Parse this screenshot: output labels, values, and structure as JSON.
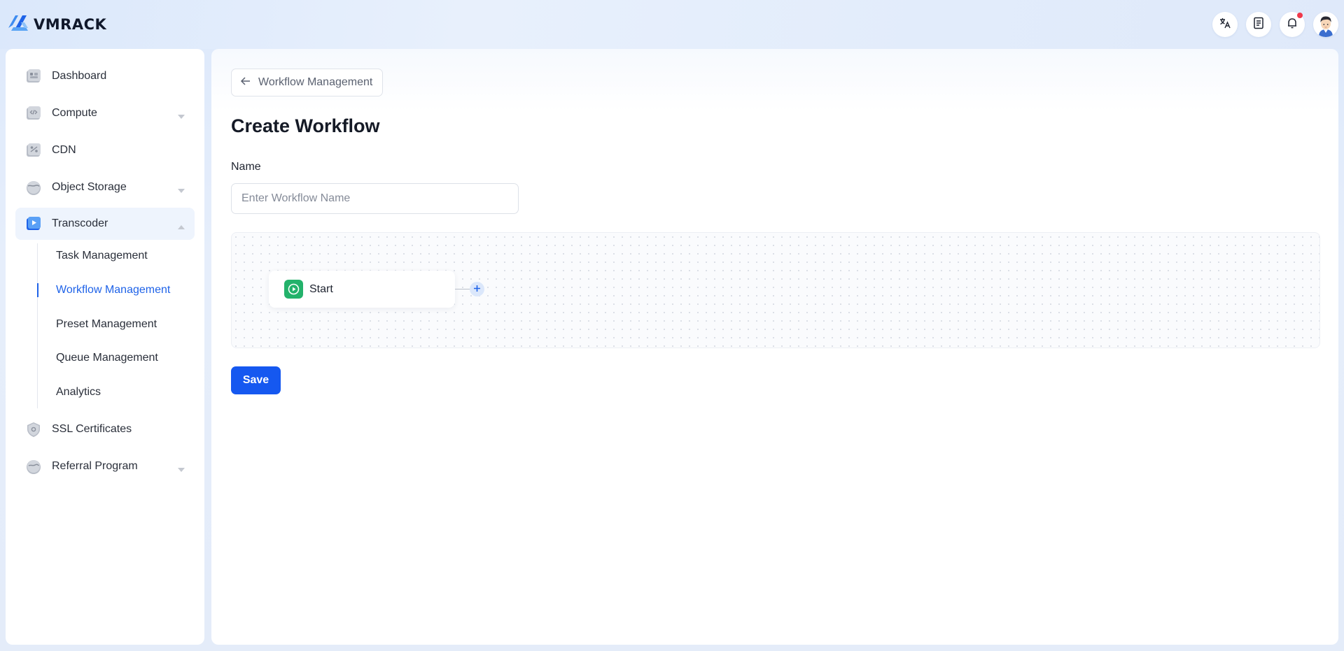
{
  "app": {
    "logo_text": "VMRACK",
    "brand_color": "#1f63e8"
  },
  "header": {
    "actions": [
      {
        "name": "translate-icon"
      },
      {
        "name": "document-icon"
      },
      {
        "name": "bell-icon",
        "has_notification": true
      },
      {
        "name": "avatar"
      }
    ]
  },
  "sidebar": {
    "items": [
      {
        "label": "Dashboard",
        "icon": "dashboard-icon"
      },
      {
        "label": "Compute",
        "icon": "compute-icon",
        "expandable": true
      },
      {
        "label": "CDN",
        "icon": "cdn-icon"
      },
      {
        "label": "Object Storage",
        "icon": "object-storage-icon",
        "expandable": true
      },
      {
        "label": "Transcoder",
        "icon": "transcoder-icon",
        "expanded": true
      },
      {
        "label": "SSL Certificates",
        "icon": "ssl-icon"
      },
      {
        "label": "Referral Program",
        "icon": "referral-icon",
        "expandable": true
      }
    ],
    "transcoder_children": [
      {
        "label": "Task Management"
      },
      {
        "label": "Workflow Management",
        "active": true
      },
      {
        "label": "Preset Management"
      },
      {
        "label": "Queue Management"
      },
      {
        "label": "Analytics"
      }
    ]
  },
  "main": {
    "back_label": "Workflow Management",
    "title": "Create Workflow",
    "name_label": "Name",
    "name_value": "",
    "name_placeholder": "Enter Workflow Name",
    "start_node_label": "Start",
    "save_label": "Save"
  }
}
